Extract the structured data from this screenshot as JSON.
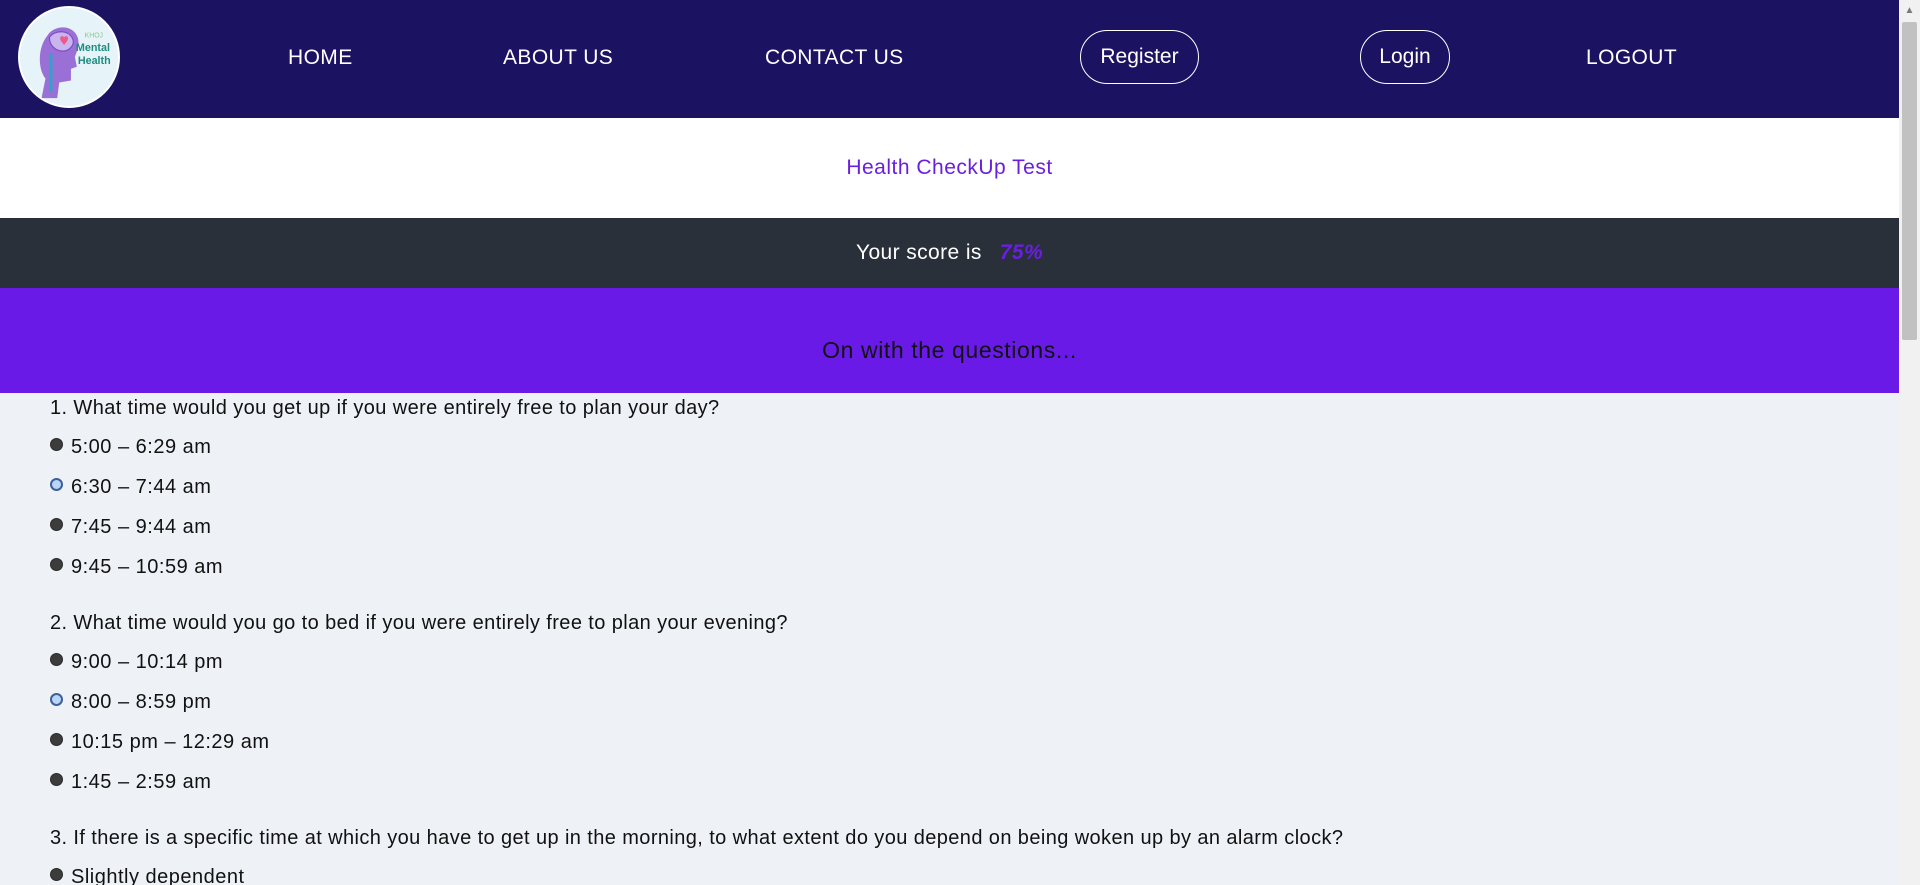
{
  "logo": {
    "small_text": "KHOJ",
    "line1": "Mental",
    "line2": "Health"
  },
  "nav": {
    "home": "HOME",
    "about": "ABOUT US",
    "contact": "CONTACT US",
    "register": "Register",
    "login": "Login",
    "logout": "LOGOUT"
  },
  "title": "Health CheckUp Test",
  "score": {
    "label": "Your score is",
    "value": "75%"
  },
  "banner": "On with the questions...",
  "questions": [
    {
      "text": "1. What time would you get up if you were entirely free to plan your day?",
      "options": [
        {
          "label": "5:00 – 6:29 am",
          "checked": false
        },
        {
          "label": "6:30 – 7:44 am",
          "checked": true
        },
        {
          "label": "7:45 – 9:44 am",
          "checked": false
        },
        {
          "label": "9:45 – 10:59 am",
          "checked": false
        }
      ]
    },
    {
      "text": "2. What time would you go to bed if you were entirely free to plan your evening?",
      "options": [
        {
          "label": "9:00 – 10:14 pm",
          "checked": false
        },
        {
          "label": "8:00 – 8:59 pm",
          "checked": true
        },
        {
          "label": "10:15 pm – 12:29 am",
          "checked": false
        },
        {
          "label": "1:45 – 2:59 am",
          "checked": false
        }
      ]
    },
    {
      "text": "3. If there is a specific time at which you have to get up in the morning, to what extent do you depend on being woken up by an alarm clock?",
      "options": [
        {
          "label": "Slightly dependent",
          "checked": false
        }
      ]
    }
  ],
  "colors": {
    "navbar": "#1c1262",
    "accent": "#691ae7",
    "score_band": "#29303a",
    "page_bg": "#eef2f7"
  }
}
